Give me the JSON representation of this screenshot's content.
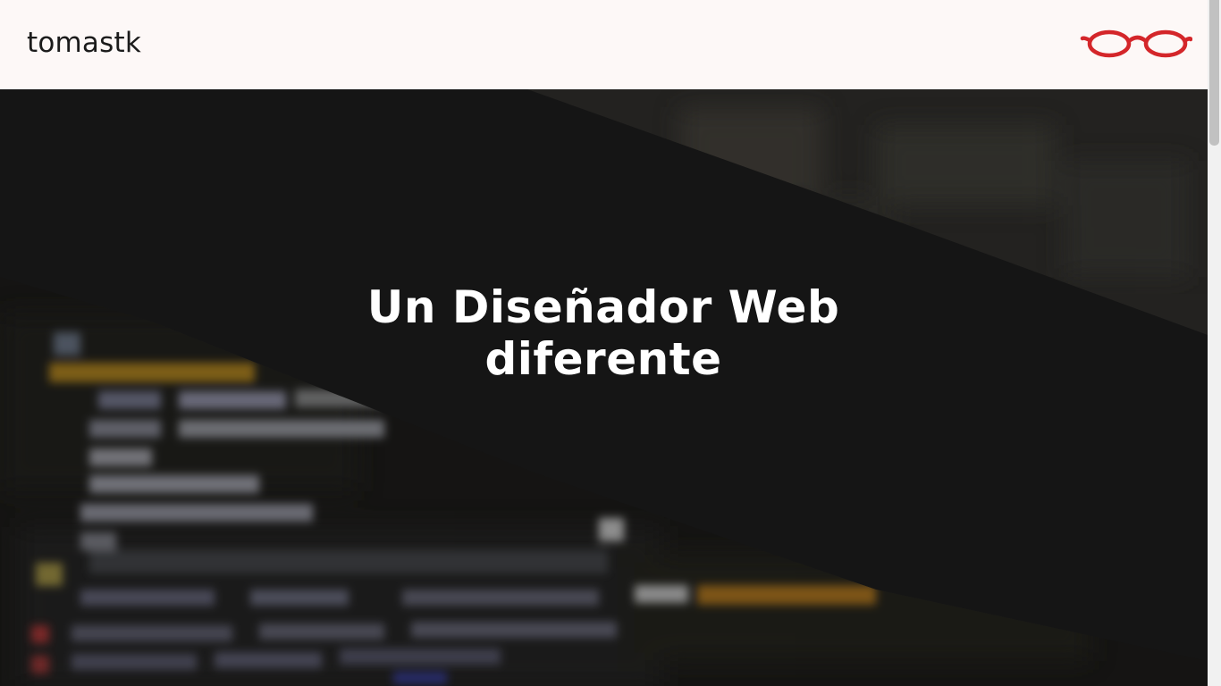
{
  "header": {
    "site_name": "tomastk",
    "menu_icon": "glasses-icon",
    "menu_icon_color": "#d4262a"
  },
  "hero": {
    "headline_line1": "Un Diseñador Web",
    "headline_line2": "diferente",
    "background": "blurred-code-editor-image"
  },
  "colors": {
    "header_bg": "#fdf8f7",
    "hero_bg": "#151515",
    "text_dark": "#1b1b1b",
    "accent": "#d4262a"
  }
}
